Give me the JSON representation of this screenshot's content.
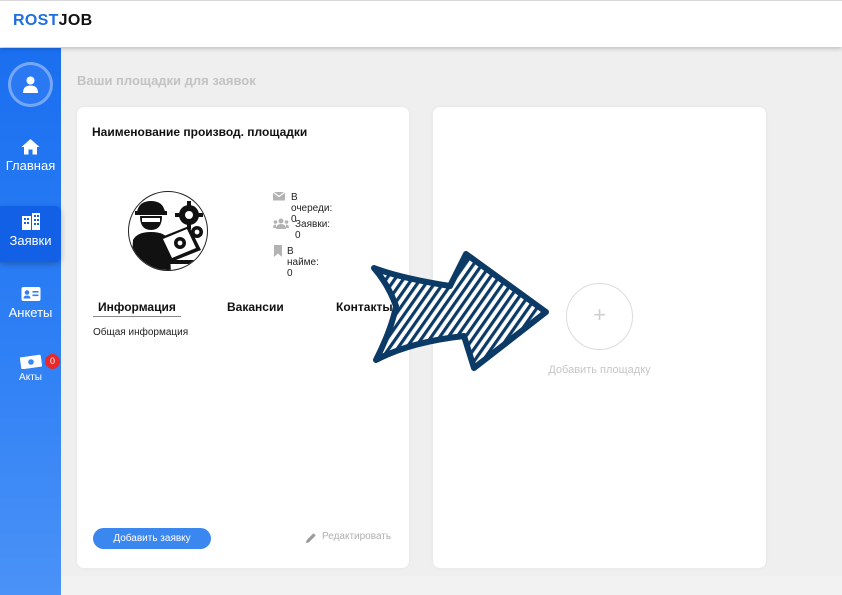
{
  "app": {
    "logo_part1": "ROST",
    "logo_part2": "JOB",
    "accent_color": "#1f6fe0"
  },
  "sidebar": {
    "avatar_icon": "user-icon",
    "items": [
      {
        "label": "Главная",
        "icon": "home-icon",
        "active": false
      },
      {
        "label": "Заявки",
        "icon": "buildings-icon",
        "active": true
      },
      {
        "label": "Анкеты",
        "icon": "id-card-icon",
        "active": false
      },
      {
        "label": "Акты",
        "icon": "money-icon",
        "active": false,
        "badge": "0"
      }
    ]
  },
  "main": {
    "title": "Ваши площадки для заявок",
    "site_card": {
      "title": "Наименование производ. площадки",
      "stats": [
        {
          "icon": "envelope-icon",
          "text": "В очереди: 0"
        },
        {
          "icon": "users-icon",
          "text": "Заявки: 0"
        },
        {
          "icon": "bookmark-icon",
          "text": "В найме: 0"
        }
      ],
      "tabs": [
        {
          "label": "Информация",
          "active": true
        },
        {
          "label": "Вакансии",
          "active": false
        },
        {
          "label": "Контакты",
          "active": false
        }
      ],
      "tab_content": "Общая информация",
      "add_request_button": "Добавить заявку",
      "edit_link": "Редактировать"
    },
    "add_card": {
      "plus": "+",
      "label": "Добавить площадку"
    }
  }
}
